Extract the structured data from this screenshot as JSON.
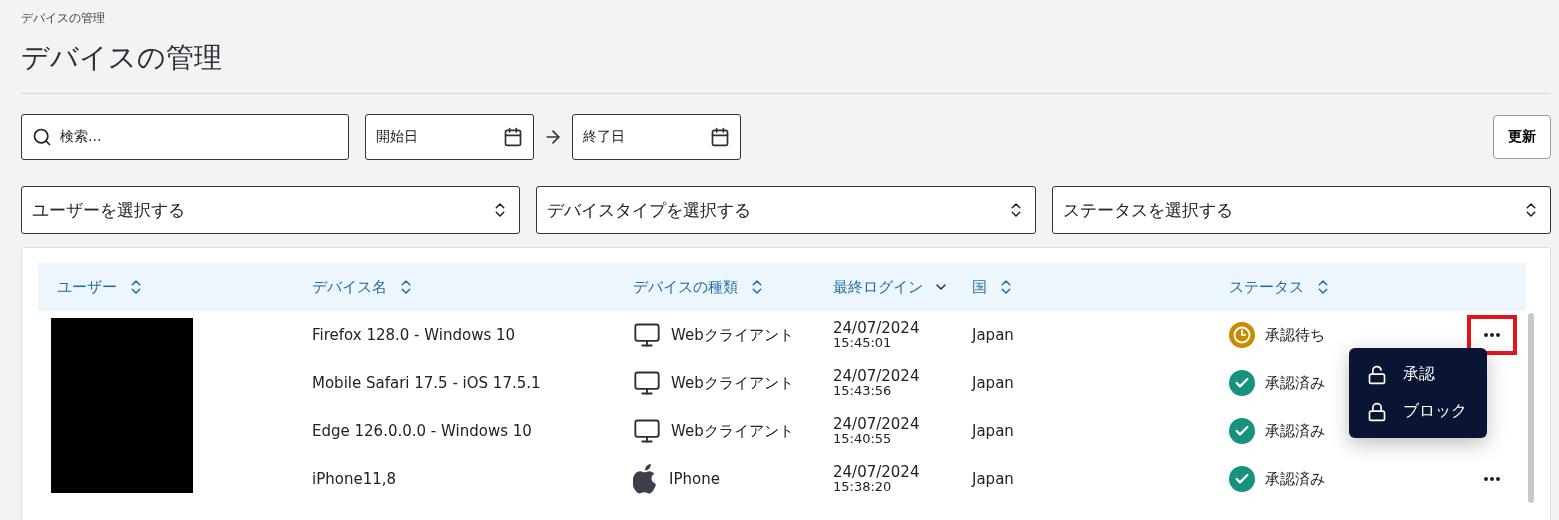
{
  "breadcrumb": "デバイスの管理",
  "title": "デバイスの管理",
  "search": {
    "placeholder": "検索..."
  },
  "date_range": {
    "start_placeholder": "開始日",
    "end_placeholder": "終了日"
  },
  "refresh_button": "更新",
  "filters": [
    {
      "placeholder": "ユーザーを選択する"
    },
    {
      "placeholder": "デバイスタイプを選択する"
    },
    {
      "placeholder": "ステータスを選択する"
    }
  ],
  "table": {
    "columns": [
      {
        "label": "ユーザー",
        "sorted": false
      },
      {
        "label": "デバイス名",
        "sorted": false
      },
      {
        "label": "デバイスの種類",
        "sorted": false
      },
      {
        "label": "最終ログイン",
        "sorted": true
      },
      {
        "label": "国",
        "sorted": false
      },
      {
        "label": "ステータス",
        "sorted": false
      }
    ],
    "user_redacted": true,
    "rows": [
      {
        "device_name": "Firefox 128.0 - Windows 10",
        "device_type": {
          "kind": "desktop",
          "label": "Webクライアント"
        },
        "date": "24/07/2024",
        "time": "15:45:01",
        "country": "Japan",
        "status": {
          "kind": "pending",
          "label": "承認待ち"
        },
        "actions": {
          "highlighted": true
        }
      },
      {
        "device_name": "Mobile Safari 17.5 - iOS 17.5.1",
        "device_type": {
          "kind": "desktop",
          "label": "Webクライアント"
        },
        "date": "24/07/2024",
        "time": "15:43:56",
        "country": "Japan",
        "status": {
          "kind": "approved",
          "label": "承認済み"
        }
      },
      {
        "device_name": "Edge 126.0.0.0 - Windows 10",
        "device_type": {
          "kind": "desktop",
          "label": "Webクライアント"
        },
        "date": "24/07/2024",
        "time": "15:40:55",
        "country": "Japan",
        "status": {
          "kind": "approved",
          "label": "承認済み"
        }
      },
      {
        "device_name": "iPhone11,8",
        "device_type": {
          "kind": "apple",
          "label": "IPhone"
        },
        "date": "24/07/2024",
        "time": "15:38:20",
        "country": "Japan",
        "status": {
          "kind": "approved",
          "label": "承認済み"
        },
        "actions": {
          "highlighted": false
        }
      }
    ]
  },
  "action_menu": {
    "items": [
      {
        "kind": "unlock",
        "label": "承認"
      },
      {
        "kind": "lock",
        "label": "ブロック"
      }
    ]
  }
}
